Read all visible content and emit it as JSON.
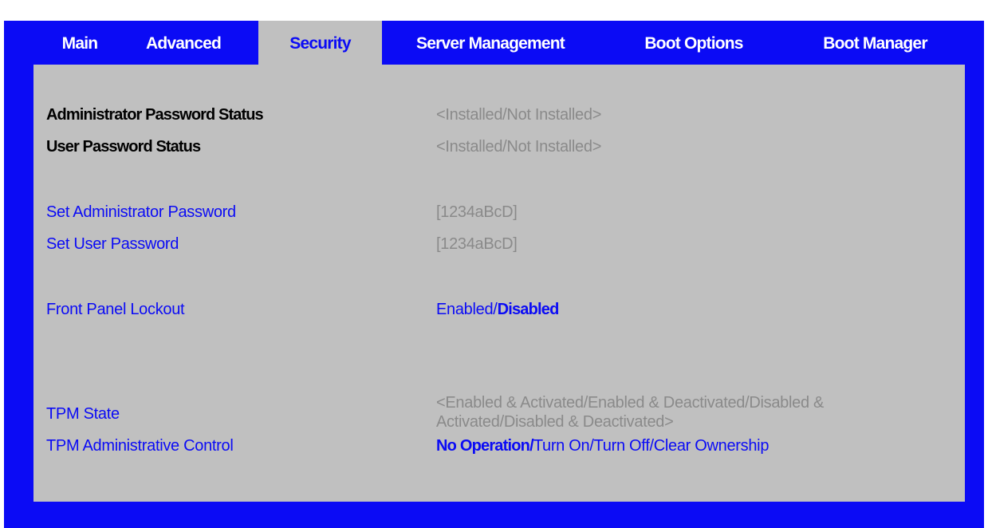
{
  "tabs": [
    {
      "label": "Main"
    },
    {
      "label": "Advanced"
    },
    {
      "label": "Security"
    },
    {
      "label": "Server Management"
    },
    {
      "label": "Boot Options"
    },
    {
      "label": "Boot Manager"
    }
  ],
  "active_tab": "Security",
  "status": {
    "admin_label": "Administrator Password Status",
    "admin_value": "<Installed/Not Installed>",
    "user_label": "User Password Status",
    "user_value": "<Installed/Not Installed>"
  },
  "passwords": {
    "set_admin_label": "Set Administrator Password",
    "set_admin_value": "[1234aBcD]",
    "set_user_label": "Set User Password",
    "set_user_value": "[1234aBcD]"
  },
  "front_panel": {
    "label": "Front Panel Lockout",
    "option_enabled": "Enabled/",
    "option_disabled_selected": "Disabled"
  },
  "tpm": {
    "state_label": "TPM State",
    "state_value": "<Enabled & Activated/Enabled & Deactivated/Disabled & Activated/Disabled & Deactivated>",
    "admin_control_label": "TPM Administrative Control",
    "admin_control_selected": "No Operation/",
    "admin_control_rest": "Turn On/Turn Off/Clear Ownership"
  },
  "colors": {
    "bios_blue": "#0b0bf5",
    "panel_gray": "#c0c0c0",
    "value_gray": "#8a8a8a"
  }
}
